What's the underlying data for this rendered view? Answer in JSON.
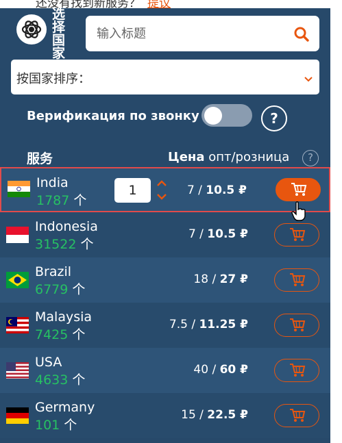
{
  "notice": {
    "text": "还没有找到新服务？",
    "link": "提议"
  },
  "logo": {
    "name": "openai-logo",
    "text": "选择国家"
  },
  "search": {
    "placeholder": "输入标题"
  },
  "sort": {
    "label": "按国家排序："
  },
  "verification": {
    "label": "Верификация по звонку",
    "enabled": false,
    "help": "?"
  },
  "table_header": {
    "service": "服务",
    "price_bold": "Цена",
    "price_rest": " опт/розница",
    "help": "?"
  },
  "colors": {
    "accent": "#e8560f",
    "panel": "#27496a",
    "count": "#27c063"
  },
  "rows": [
    {
      "country": "India",
      "count": "1787",
      "unit": "个",
      "price_opt": "7 / ",
      "price_retail": "10.5 ₽",
      "flag": "india-flag-icon",
      "qty": "1",
      "selected": true
    },
    {
      "country": "Indonesia",
      "count": "31522",
      "unit": "个",
      "price_opt": "7 / ",
      "price_retail": "10.5 ₽",
      "flag": "indonesia-flag-icon"
    },
    {
      "country": "Brazil",
      "count": "6779",
      "unit": "个",
      "price_opt": "18 / ",
      "price_retail": "27 ₽",
      "flag": "brazil-flag-icon"
    },
    {
      "country": "Malaysia",
      "count": "7425",
      "unit": "个",
      "price_opt": "7.5 / ",
      "price_retail": "11.25 ₽",
      "flag": "malaysia-flag-icon"
    },
    {
      "country": "USA",
      "count": "4633",
      "unit": "个",
      "price_opt": "40 / ",
      "price_retail": "60 ₽",
      "flag": "usa-flag-icon"
    },
    {
      "country": "Germany",
      "count": "101",
      "unit": "个",
      "price_opt": "15 / ",
      "price_retail": "22.5 ₽",
      "flag": "germany-flag-icon"
    }
  ]
}
